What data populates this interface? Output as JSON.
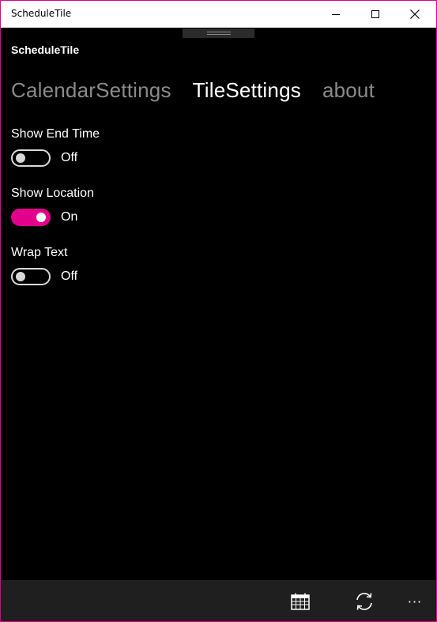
{
  "window": {
    "title": "ScheduleTile"
  },
  "app": {
    "title": "ScheduleTile"
  },
  "pivot": {
    "items": [
      {
        "label": "CalendarSettings",
        "active": false
      },
      {
        "label": "TileSettings",
        "active": true
      },
      {
        "label": "about",
        "active": false
      }
    ]
  },
  "settings": [
    {
      "label": "Show End Time",
      "state": "Off",
      "on": false
    },
    {
      "label": "Show Location",
      "state": "On",
      "on": true
    },
    {
      "label": "Wrap Text",
      "state": "Off",
      "on": false
    }
  ],
  "appbar": {
    "buttons": [
      "calendar-icon",
      "sync-icon",
      "more-icon"
    ],
    "more_label": "···"
  },
  "colors": {
    "accent": "#e3008c",
    "background": "#000000",
    "appbar": "#1f1f1f"
  }
}
